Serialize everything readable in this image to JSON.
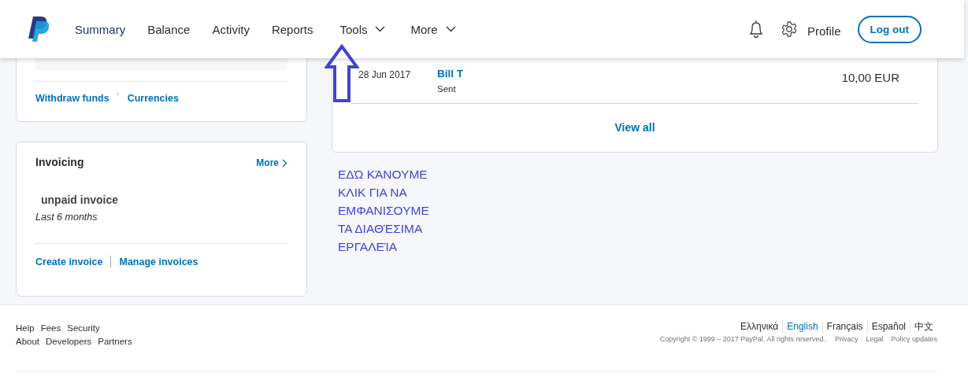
{
  "header": {
    "nav": [
      {
        "label": "Summary",
        "dropdown": false
      },
      {
        "label": "Balance",
        "dropdown": false
      },
      {
        "label": "Activity",
        "dropdown": false
      },
      {
        "label": "Reports",
        "dropdown": false
      },
      {
        "label": "Tools",
        "dropdown": true
      },
      {
        "label": "More",
        "dropdown": true
      }
    ],
    "profile": "Profile",
    "logout": "Log out"
  },
  "balance_card": {
    "links": [
      "Withdraw funds",
      "Currencies"
    ]
  },
  "invoicing_card": {
    "title": "Invoicing",
    "more": "More",
    "summary": "unpaid invoice",
    "period": "Last 6 months",
    "links": [
      "Create invoice",
      "Manage invoices"
    ]
  },
  "activity_card": {
    "rows": [
      {
        "date": "28 Jun 2017",
        "name": "Bill T",
        "status": "Sent",
        "amount": "10,00 EUR"
      }
    ],
    "view_all": "View all"
  },
  "annotation": {
    "lines": [
      "ΕΔΏ ΚΆΝΟΥΜΕ",
      "ΚΛΙΚ ΓΙΑ ΝΑ",
      "ΕΜΦΑΝΙΣΟΥΜΕ",
      "ΤΑ ΔΙΑΘΈΣΙΜΑ",
      "ΕΡΓΑΛΕΊΑ"
    ]
  },
  "footer": {
    "links_row_1": [
      "Help",
      "Fees",
      "Security"
    ],
    "links_row_2": [
      "About",
      "Developers",
      "Partners"
    ],
    "languages": [
      {
        "label": "Ελληνικά",
        "selected": false
      },
      {
        "label": "English",
        "selected": true
      },
      {
        "label": "Français",
        "selected": false
      },
      {
        "label": "Español",
        "selected": false
      },
      {
        "label": "中文",
        "selected": false
      }
    ],
    "copyright": "Copyright © 1999 – 2017 PayPal. All rights reserved.",
    "legal_links": [
      "Privacy",
      "Legal",
      "Policy updates"
    ]
  }
}
